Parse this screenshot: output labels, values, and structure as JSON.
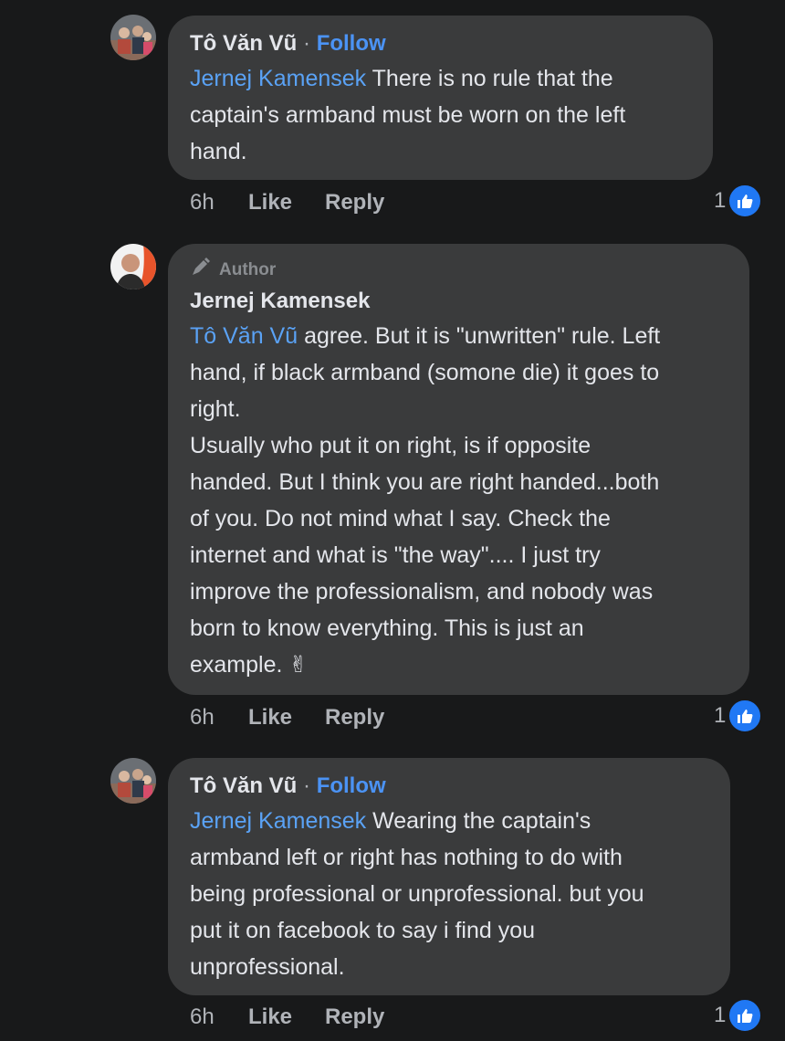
{
  "comments": [
    {
      "author": "Tô Văn Vũ",
      "separator": "·",
      "follow_label": "Follow",
      "mention": "Jernej Kamensek",
      "lines": [
        " There is no rule that the",
        "captain's armband must be worn on the left",
        "hand."
      ],
      "time": "6h",
      "like_label": "Like",
      "reply_label": "Reply",
      "reaction_count": "1"
    },
    {
      "badge": "Author",
      "author": "Jernej Kamensek",
      "mention": "Tô Văn Vũ",
      "lines": [
        " agree. But it is \"unwritten\" rule. Left",
        "hand, if black armband (somone die) it goes to",
        "right.",
        "Usually who put it on right, is if opposite",
        "handed. But I think you are right handed...both",
        "of you. Do not mind what I say. Check the",
        "internet and what is \"the way\".... I just try",
        "improve the professionalism, and nobody was",
        "born to know everything. This is just an",
        "example. ✌"
      ],
      "time": "6h",
      "like_label": "Like",
      "reply_label": "Reply",
      "reaction_count": "1"
    },
    {
      "author": "Tô Văn Vũ",
      "separator": "·",
      "follow_label": "Follow",
      "mention": "Jernej Kamensek",
      "lines": [
        " Wearing the captain's",
        "armband left or right has nothing to do with",
        "being professional or unprofessional. but you",
        "put it on facebook to say i find you",
        "unprofessional."
      ],
      "time": "6h",
      "like_label": "Like",
      "reply_label": "Reply",
      "reaction_count": "1"
    }
  ],
  "colors": {
    "background": "#18191a",
    "bubble": "#3a3b3c",
    "link": "#4b93f5",
    "like_badge": "#2078f4"
  },
  "icons": {
    "author_badge": "pencil-icon",
    "reaction": "thumbs-up-icon",
    "avatar_1": "avatar-group-photo",
    "avatar_2": "avatar-portrait"
  }
}
